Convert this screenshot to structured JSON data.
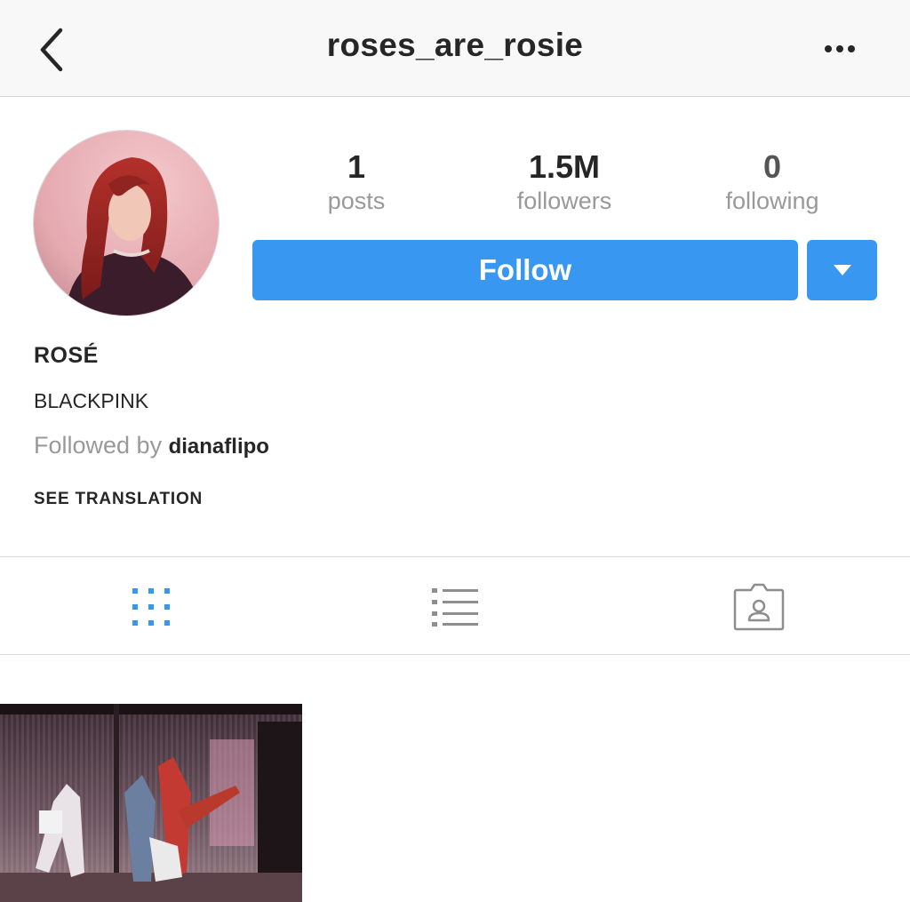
{
  "header": {
    "username": "roses_are_rosie",
    "back_icon": "chevron-left-icon",
    "more_icon": "more-horizontal-icon"
  },
  "stats": [
    {
      "value": "1",
      "label": "posts"
    },
    {
      "value": "1.5M",
      "label": "followers"
    },
    {
      "value": "0",
      "label": "following"
    }
  ],
  "actions": {
    "follow_label": "Follow",
    "dropdown_icon": "triangle-down-icon"
  },
  "profile": {
    "display_name": "ROSÉ",
    "bio": "BLACKPINK",
    "followed_by_prefix": "Followed by",
    "followed_by_user": "dianaflipo",
    "see_translation": "SEE TRANSLATION"
  },
  "tabs": [
    {
      "icon": "grid-icon",
      "active": true
    },
    {
      "icon": "list-icon",
      "active": false
    },
    {
      "icon": "tagged-photos-icon",
      "active": false
    }
  ],
  "colors": {
    "accent": "#3897f0",
    "muted_text": "#999999",
    "tab_inactive": "#8e8e8e"
  }
}
